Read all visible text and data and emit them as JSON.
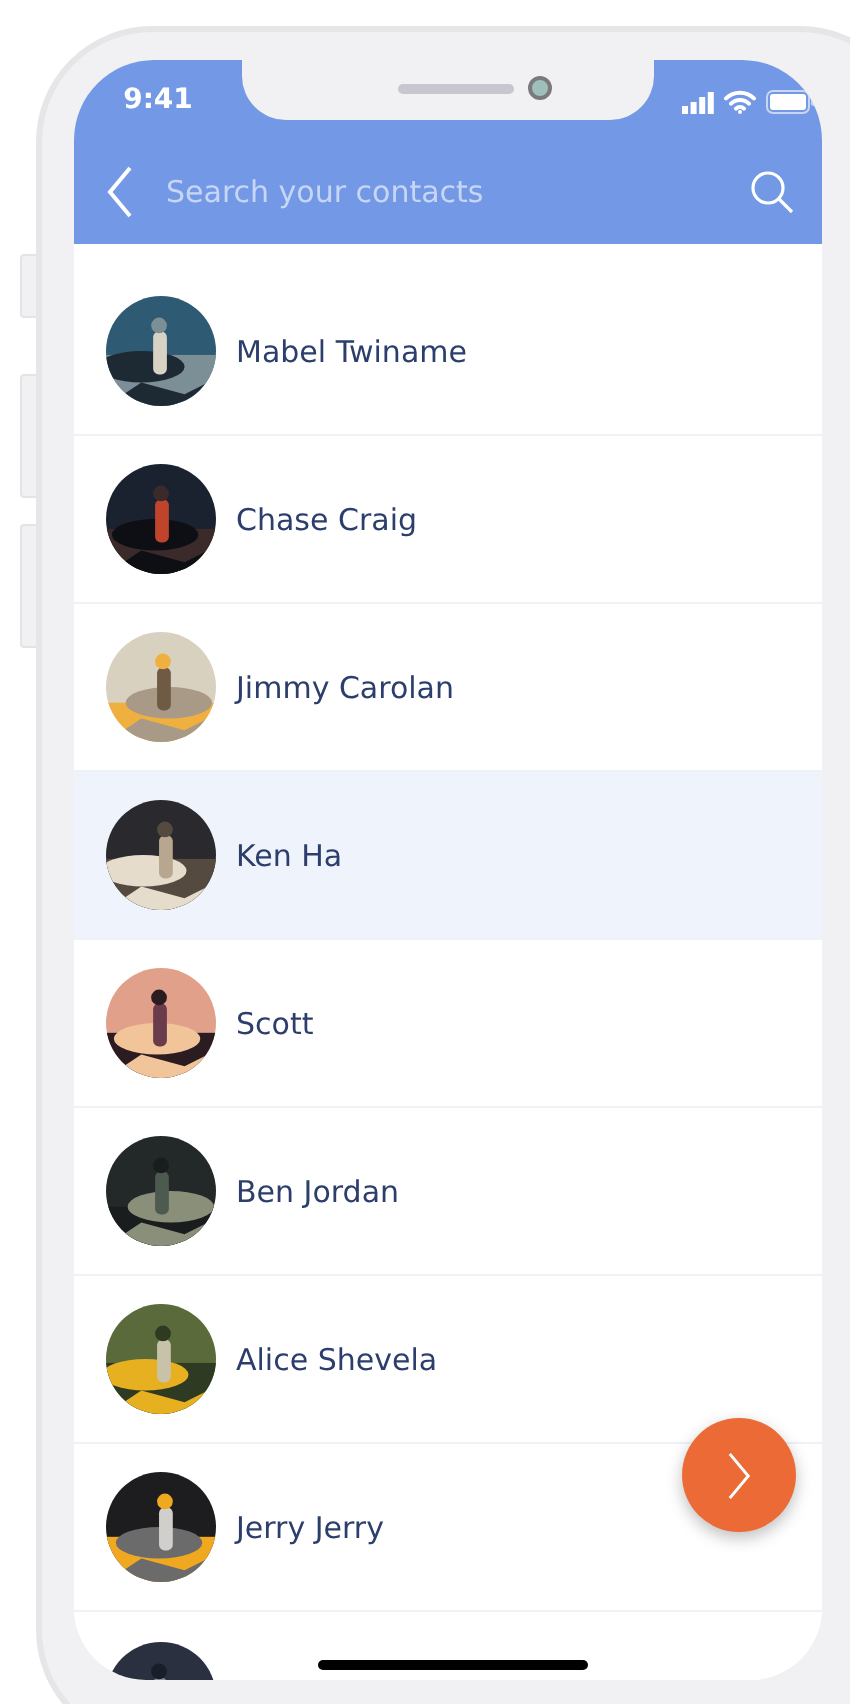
{
  "status_bar": {
    "time": "9:41"
  },
  "search": {
    "placeholder": "Search your contacts"
  },
  "contacts": [
    {
      "name": "Mabel Twiname",
      "selected": false
    },
    {
      "name": "Chase Craig",
      "selected": false
    },
    {
      "name": "Jimmy Carolan",
      "selected": false
    },
    {
      "name": "Ken Ha",
      "selected": true
    },
    {
      "name": "Scott",
      "selected": false
    },
    {
      "name": "Ben Jordan",
      "selected": false
    },
    {
      "name": "Alice Shevela",
      "selected": false
    },
    {
      "name": "Jerry Jerry",
      "selected": false
    }
  ]
}
